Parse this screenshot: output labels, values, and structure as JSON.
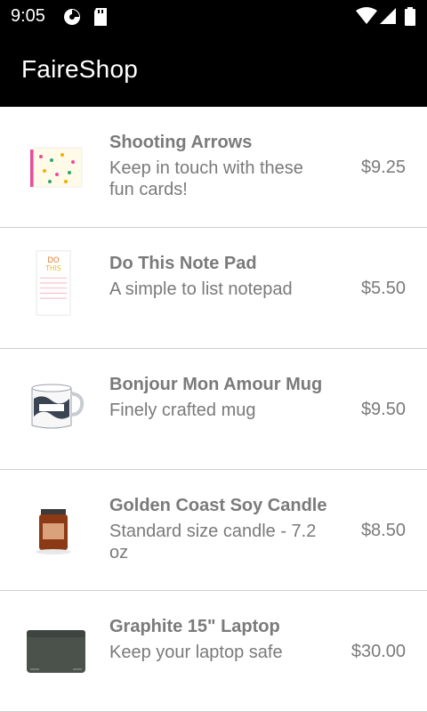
{
  "status_bar": {
    "time": "9:05"
  },
  "app": {
    "title": "FaireShop"
  },
  "products": [
    {
      "name": "Shooting Arrows",
      "description": "Keep in touch with these fun cards!",
      "price": "$9.25",
      "icon": "card-image-icon"
    },
    {
      "name": "Do This Note Pad",
      "description": "A simple to list notepad",
      "price": "$5.50",
      "icon": "notepad-image-icon"
    },
    {
      "name": "Bonjour Mon Amour Mug",
      "description": "Finely crafted mug",
      "price": "$9.50",
      "icon": "mug-image-icon"
    },
    {
      "name": "Golden Coast Soy Candle",
      "description": "Standard size candle - 7.2 oz",
      "price": "$8.50",
      "icon": "candle-image-icon"
    },
    {
      "name": "Graphite 15\" Laptop",
      "description": "Keep your laptop safe",
      "price": "$30.00",
      "icon": "laptop-sleeve-image-icon"
    }
  ]
}
